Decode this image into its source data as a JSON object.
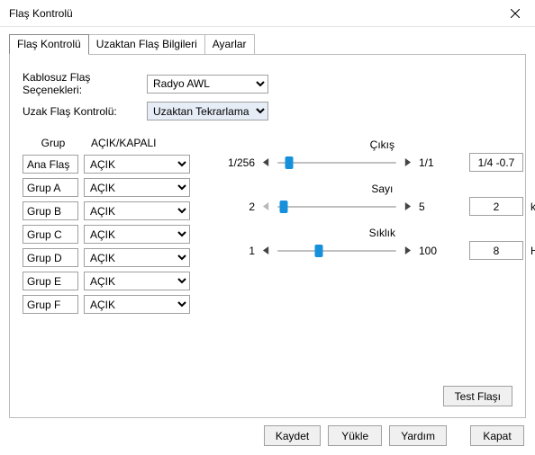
{
  "window": {
    "title": "Flaş Kontrolü"
  },
  "tabs": [
    "Flaş Kontrolü",
    "Uzaktan Flaş Bilgileri",
    "Ayarlar"
  ],
  "active_tab": 0,
  "form": {
    "wireless_label": "Kablosuz Flaş Seçenekleri:",
    "wireless_value": "Radyo AWL",
    "remote_label": "Uzak Flaş Kontrolü:",
    "remote_value": "Uzaktan Tekrarlama"
  },
  "group_headers": {
    "col1": "Grup",
    "col2": "AÇIK/KAPALI"
  },
  "groups": [
    {
      "name": "Ana Flaş",
      "state": "AÇIK"
    },
    {
      "name": "Grup A",
      "state": "AÇIK"
    },
    {
      "name": "Grup B",
      "state": "AÇIK"
    },
    {
      "name": "Grup C",
      "state": "AÇIK"
    },
    {
      "name": "Grup D",
      "state": "AÇIK"
    },
    {
      "name": "Grup E",
      "state": "AÇIK"
    },
    {
      "name": "Grup F",
      "state": "AÇIK"
    }
  ],
  "sliders": {
    "output": {
      "label": "Çıkış",
      "min_label": "1/256",
      "max_label": "1/1",
      "value_display": "1/4 -0.7",
      "thumb_pct": 10
    },
    "count": {
      "label": "Sayı",
      "min_label": "2",
      "max_label": "5",
      "value_display": "2",
      "unit": "kez",
      "thumb_pct": 5
    },
    "freq": {
      "label": "Sıklık",
      "min_label": "1",
      "max_label": "100",
      "value_display": "8",
      "unit": "Hz",
      "thumb_pct": 35
    }
  },
  "buttons": {
    "test": "Test Flaşı",
    "save": "Kaydet",
    "load": "Yükle",
    "help": "Yardım",
    "close": "Kapat"
  }
}
